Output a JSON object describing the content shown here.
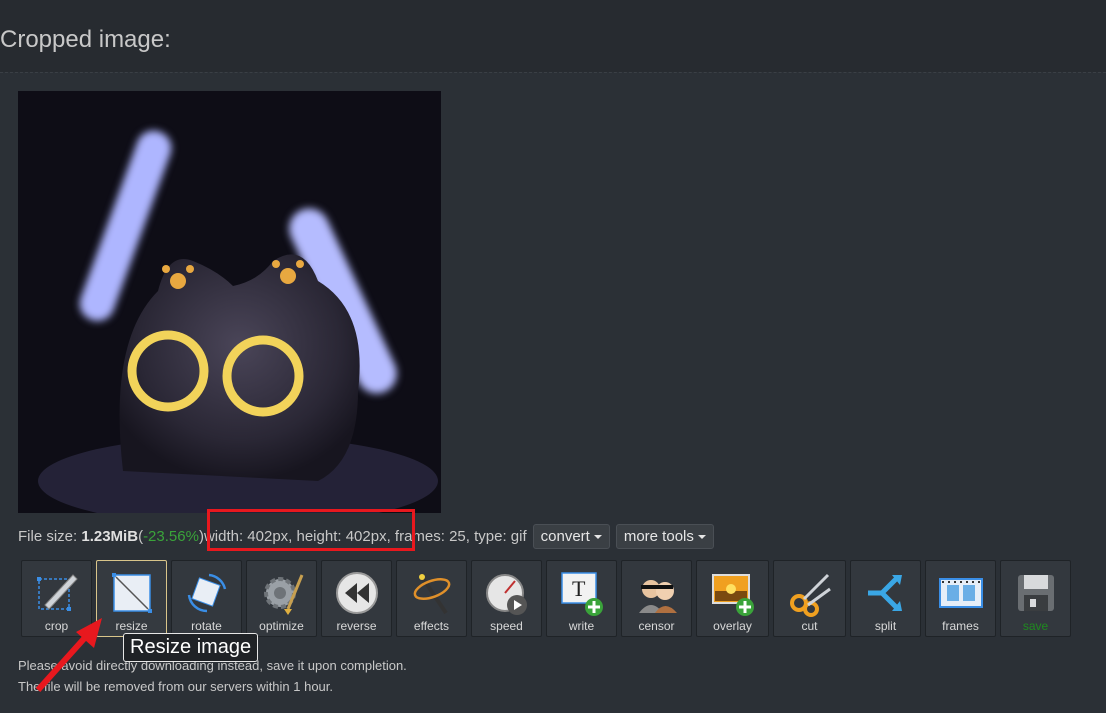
{
  "page": {
    "title": "Cropped image:"
  },
  "info": {
    "file_size_label": "File size:",
    "file_size": "1.23MiB",
    "open_paren": " (",
    "size_change": "-23.56%",
    "close_paren": ")",
    "dims": " width: 402px, height: 402px, frames: 25, type: gif"
  },
  "buttons": {
    "convert": "convert",
    "more_tools": "more tools"
  },
  "tools": [
    {
      "label": "crop",
      "icon": "crop-icon"
    },
    {
      "label": "resize",
      "icon": "resize-icon"
    },
    {
      "label": "rotate",
      "icon": "rotate-icon"
    },
    {
      "label": "optimize",
      "icon": "optimize-icon"
    },
    {
      "label": "reverse",
      "icon": "reverse-icon"
    },
    {
      "label": "effects",
      "icon": "effects-icon"
    },
    {
      "label": "speed",
      "icon": "speed-icon"
    },
    {
      "label": "write",
      "icon": "write-icon"
    },
    {
      "label": "censor",
      "icon": "censor-icon"
    },
    {
      "label": "overlay",
      "icon": "overlay-icon"
    },
    {
      "label": "cut",
      "icon": "cut-icon"
    },
    {
      "label": "split",
      "icon": "split-icon"
    },
    {
      "label": "frames",
      "icon": "frames-icon"
    },
    {
      "label": "save",
      "icon": "save-icon"
    }
  ],
  "tooltip": "Resize image",
  "notes": {
    "line1": "Please avoid directly downloading instead, save it upon completion.",
    "line2": "The file will be removed from our servers within 1 hour."
  },
  "colors": {
    "highlight": "#e8181e",
    "size_change": "#3aa33a",
    "active_tool_border": "#d9c58a"
  }
}
